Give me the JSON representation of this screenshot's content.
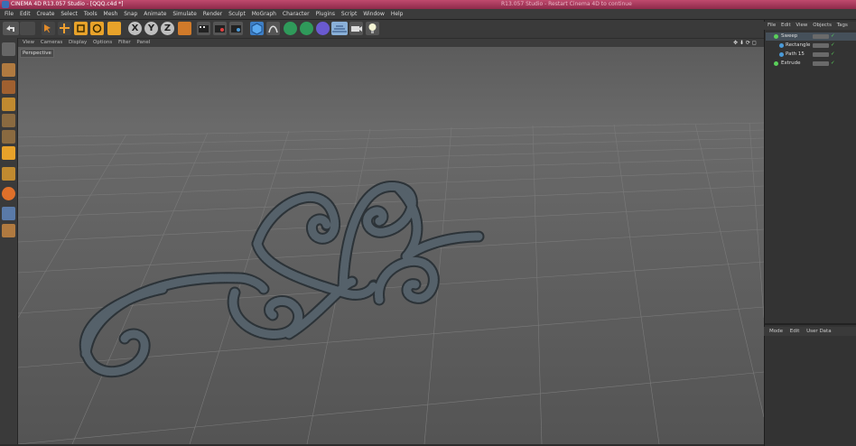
{
  "titlebar": {
    "title": "CINEMA 4D R13.057 Studio - [QQQ.c4d *]",
    "right_title": "R13.057 Studio - Restart Cinema 4D to continue"
  },
  "menu": [
    "File",
    "Edit",
    "Create",
    "Select",
    "Tools",
    "Mesh",
    "Snap",
    "Animate",
    "Simulate",
    "Render",
    "Sculpt",
    "MoGraph",
    "Character",
    "Plugins",
    "Script",
    "Window",
    "Help"
  ],
  "toolbar": {
    "icons": [
      "undo-icon",
      "redo-icon",
      "select-icon",
      "move-icon",
      "scale-icon",
      "rotate-icon",
      "last-tool-icon",
      "x-axis-icon",
      "y-axis-icon",
      "z-axis-icon",
      "world-coordinates-icon",
      "render-view-icon",
      "render-picture-viewer-icon",
      "render-settings-icon",
      "cube-icon",
      "pen-icon",
      "nurbs-icon",
      "array-icon",
      "deformer-icon",
      "scene-icon",
      "camera-icon",
      "light-icon"
    ],
    "axis_labels": [
      "X",
      "Y",
      "Z"
    ]
  },
  "left_toolbar": {
    "icons": [
      "make-editable-icon",
      "model-mode-icon",
      "texture-mode-icon",
      "workplane-icon",
      "points-mode-icon",
      "edges-mode-icon",
      "polygons-mode-icon",
      "axis-mode-icon",
      "tweak-mode-icon",
      "snap-icon",
      "solo-icon"
    ]
  },
  "viewport": {
    "menu": [
      "View",
      "Cameras",
      "Display",
      "Options",
      "Filter",
      "Panel"
    ],
    "label": "Perspective"
  },
  "object_manager": {
    "menu": [
      "File",
      "Edit",
      "View",
      "Objects",
      "Tags"
    ],
    "objects": [
      {
        "name": "Sweep",
        "color": "#5ad05a"
      },
      {
        "name": "Rectangle",
        "color": "#4a9ad8"
      },
      {
        "name": "Path 15",
        "color": "#4a9ad8"
      },
      {
        "name": "Extrude",
        "color": "#5ad05a"
      }
    ]
  },
  "attribute_manager": {
    "menu": [
      "Mode",
      "Edit",
      "User Data"
    ]
  }
}
